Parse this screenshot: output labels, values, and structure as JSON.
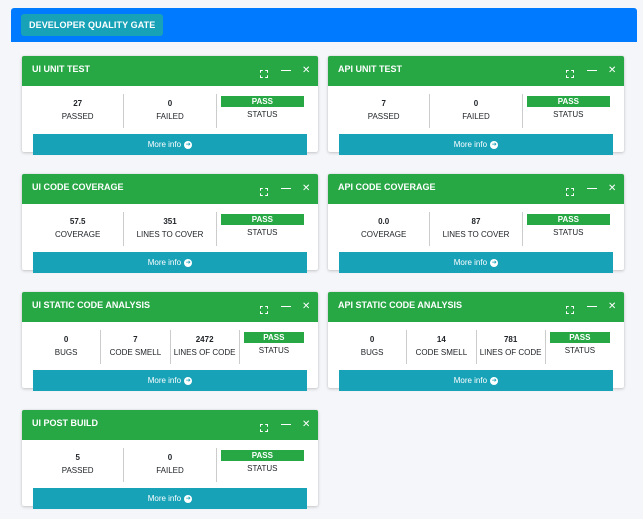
{
  "header": {
    "title": "DEVELOPER QUALITY GATE"
  },
  "colors": {
    "header_bar": "#007bff",
    "card_header": "#28a745",
    "info": "#17a2b8",
    "pass": "#28a745"
  },
  "icons": {
    "expand": "expand-icon",
    "minimize": "minus-icon",
    "close": "close-icon",
    "more": "arrow-circle-right-icon"
  },
  "cards": [
    {
      "title": "UI UNIT TEST",
      "stats": [
        {
          "value": "27",
          "label": "PASSED"
        },
        {
          "value": "0",
          "label": "FAILED"
        }
      ],
      "status": "PASS",
      "status_label": "STATUS",
      "more": "More info"
    },
    {
      "title": "API UNIT TEST",
      "stats": [
        {
          "value": "7",
          "label": "PASSED"
        },
        {
          "value": "0",
          "label": "FAILED"
        }
      ],
      "status": "PASS",
      "status_label": "STATUS",
      "more": "More info"
    },
    {
      "title": "UI CODE COVERAGE",
      "stats": [
        {
          "value": "57.5",
          "label": "COVERAGE"
        },
        {
          "value": "351",
          "label": "LINES TO COVER"
        }
      ],
      "status": "PASS",
      "status_label": "STATUS",
      "more": "More info"
    },
    {
      "title": "API CODE COVERAGE",
      "stats": [
        {
          "value": "0.0",
          "label": "COVERAGE"
        },
        {
          "value": "87",
          "label": "LINES TO COVER"
        }
      ],
      "status": "PASS",
      "status_label": "STATUS",
      "more": "More info"
    },
    {
      "title": "UI STATIC CODE ANALYSIS",
      "stats": [
        {
          "value": "0",
          "label": "BUGS"
        },
        {
          "value": "7",
          "label": "CODE SMELL"
        },
        {
          "value": "2472",
          "label": "LINES OF CODE"
        }
      ],
      "status": "PASS",
      "status_label": "STATUS",
      "more": "More info"
    },
    {
      "title": "API STATIC CODE ANALYSIS",
      "stats": [
        {
          "value": "0",
          "label": "BUGS"
        },
        {
          "value": "14",
          "label": "CODE SMELL"
        },
        {
          "value": "781",
          "label": "LINES OF CODE"
        }
      ],
      "status": "PASS",
      "status_label": "STATUS",
      "more": "More info"
    },
    {
      "title": "UI POST BUILD",
      "stats": [
        {
          "value": "5",
          "label": "PASSED"
        },
        {
          "value": "0",
          "label": "FAILED"
        }
      ],
      "status": "PASS",
      "status_label": "STATUS",
      "more": "More info"
    }
  ]
}
